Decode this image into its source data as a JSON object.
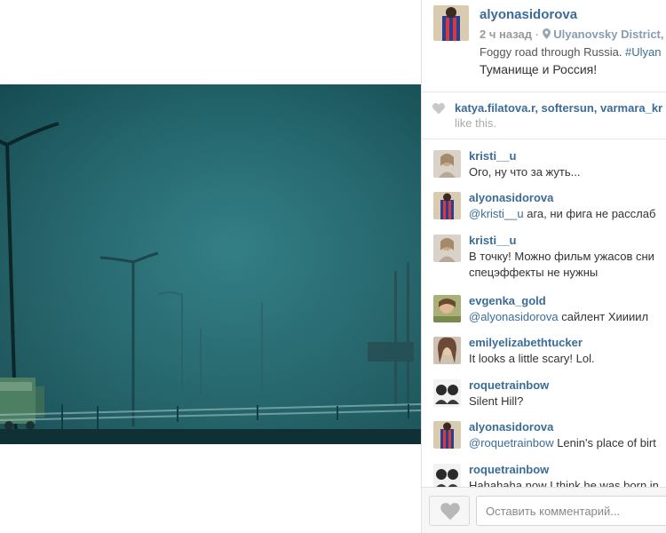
{
  "post": {
    "author": "alyonasidorova",
    "time": "2 ч назад",
    "location": "Ulyanovsky District,",
    "caption_text": "Foggy road through Russia. ",
    "caption_hashtag": "#Ulyan",
    "caption_line2": "Туманище и Россия!"
  },
  "likes": {
    "names": "katya.filatova.r, softersun, varmara_kr",
    "suffix": "like this."
  },
  "comments": [
    {
      "user": "kristi__u",
      "text": "Ого, ну что за жуть..."
    },
    {
      "user": "alyonasidorova",
      "mention": "@kristi__u",
      "text": " ага, ни фига не расслаб"
    },
    {
      "user": "kristi__u",
      "text": "В точку! Можно фильм ужасов сни",
      "text2": "спецэффекты не нужны"
    },
    {
      "user": "evgenka_gold",
      "mention": "@alyonasidorova",
      "text": " сайлент Хиииил"
    },
    {
      "user": "emilyelizabethtucker",
      "text": "It looks a little scary! Lol. "
    },
    {
      "user": "roquetrainbow",
      "text": " Silent Hill?"
    },
    {
      "user": "alyonasidorova",
      "mention": "@roquetrainbow",
      "text": " Lenin's place of birt"
    },
    {
      "user": "roquetrainbow",
      "text": "Hahahaha now I think he was born in"
    }
  ],
  "comment_input": {
    "placeholder": "Оставить комментарий..."
  },
  "icons": {
    "location": "pin-icon",
    "likes": "heart-icon",
    "like_button": "heart-icon"
  },
  "colors": {
    "link": "#3a6c98",
    "photo_fog": "#1e6269"
  }
}
